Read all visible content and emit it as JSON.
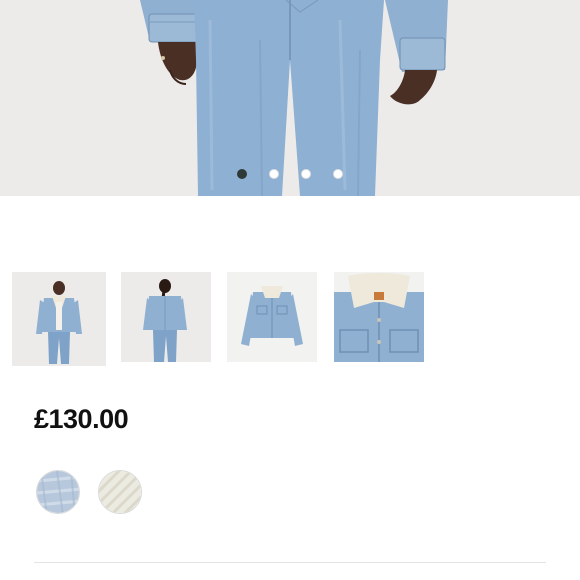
{
  "product": {
    "price": "£130.00"
  },
  "gallery": {
    "dot_count": 4,
    "active_dot": 0,
    "thumbnails": [
      {
        "name": "thumb-model-front",
        "selected": true
      },
      {
        "name": "thumb-model-back",
        "selected": false
      },
      {
        "name": "thumb-jacket-flat",
        "selected": false
      },
      {
        "name": "thumb-collar-detail",
        "selected": false
      }
    ]
  },
  "swatches": [
    {
      "name": "swatch-light-denim",
      "color": "#b8c8dc"
    },
    {
      "name": "swatch-cream",
      "color": "#ecebe2"
    }
  ],
  "colors": {
    "background": "#ffffff",
    "hero_background": "#ecebea",
    "denim": "#8fb0d0",
    "dark_denim": "#6e8fb3",
    "text": "#111111"
  }
}
